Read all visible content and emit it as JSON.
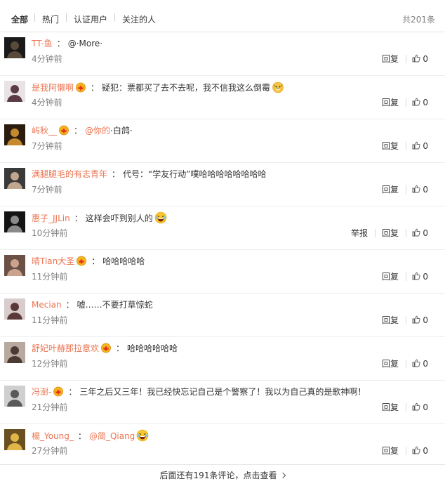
{
  "tabs": {
    "all": "全部",
    "hot": "热门",
    "verified": "认证用户",
    "following": "关注的人",
    "total": "共201条"
  },
  "comments": [
    {
      "user": "TT-鱼",
      "vip": false,
      "mention": "",
      "text": "@·More·",
      "emoji": "",
      "time": "4分钟前",
      "reply": "回复",
      "likes": "0",
      "report": ""
    },
    {
      "user": "是我阿懒啊",
      "vip": true,
      "mention": "",
      "text": "疑犯：票都买了去不去呢，我不信我这么倒霉",
      "emoji": "dog-emoji",
      "time": "4分钟前",
      "reply": "回复",
      "likes": "0",
      "report": ""
    },
    {
      "user": "屿秋__",
      "vip": true,
      "mention": "@你的",
      "text": "·白鸽·",
      "emoji": "",
      "time": "7分钟前",
      "reply": "回复",
      "likes": "0",
      "report": ""
    },
    {
      "user": "满腿腿毛的有志青年",
      "vip": false,
      "mention": "",
      "text": "代号：“学友行动”噗哈哈哈哈哈哈哈哈",
      "emoji": "",
      "time": "7分钟前",
      "reply": "回复",
      "likes": "0",
      "report": ""
    },
    {
      "user": "惠子_JJLin",
      "vip": false,
      "mention": "",
      "text": "这样会吓到别人的",
      "emoji": "laugh-emoji",
      "time": "10分钟前",
      "reply": "回复",
      "likes": "0",
      "report": "举报"
    },
    {
      "user": "晴Tian大圣",
      "vip": true,
      "mention": "",
      "text": "哈哈哈哈哈",
      "emoji": "",
      "time": "11分钟前",
      "reply": "回复",
      "likes": "0",
      "report": ""
    },
    {
      "user": "Mecian",
      "vip": false,
      "mention": "",
      "text": "嘘……不要打草惊蛇",
      "emoji": "",
      "time": "11分钟前",
      "reply": "回复",
      "likes": "0",
      "report": ""
    },
    {
      "user": "舒妃叶赫那拉意欢",
      "vip": true,
      "mention": "",
      "text": "哈哈哈哈哈哈",
      "emoji": "",
      "time": "12分钟前",
      "reply": "回复",
      "likes": "0",
      "report": ""
    },
    {
      "user": "冯澍-",
      "vip": true,
      "mention": "",
      "text": "三年之后又三年！我已经快忘记自己是个警察了！我以为自己真的是歌神啊！",
      "emoji": "",
      "time": "21分钟前",
      "reply": "回复",
      "likes": "0",
      "report": ""
    },
    {
      "user": "楊_Young_",
      "vip": false,
      "mention": "@简_Qiang",
      "text": "",
      "emoji": "laugh-emoji",
      "time": "27分钟前",
      "reply": "回复",
      "likes": "0",
      "report": ""
    }
  ],
  "more": "后面还有191条评论，点击查看",
  "colors": {
    "accent": "#eb7350",
    "muted": "#808080",
    "text": "#333333"
  }
}
